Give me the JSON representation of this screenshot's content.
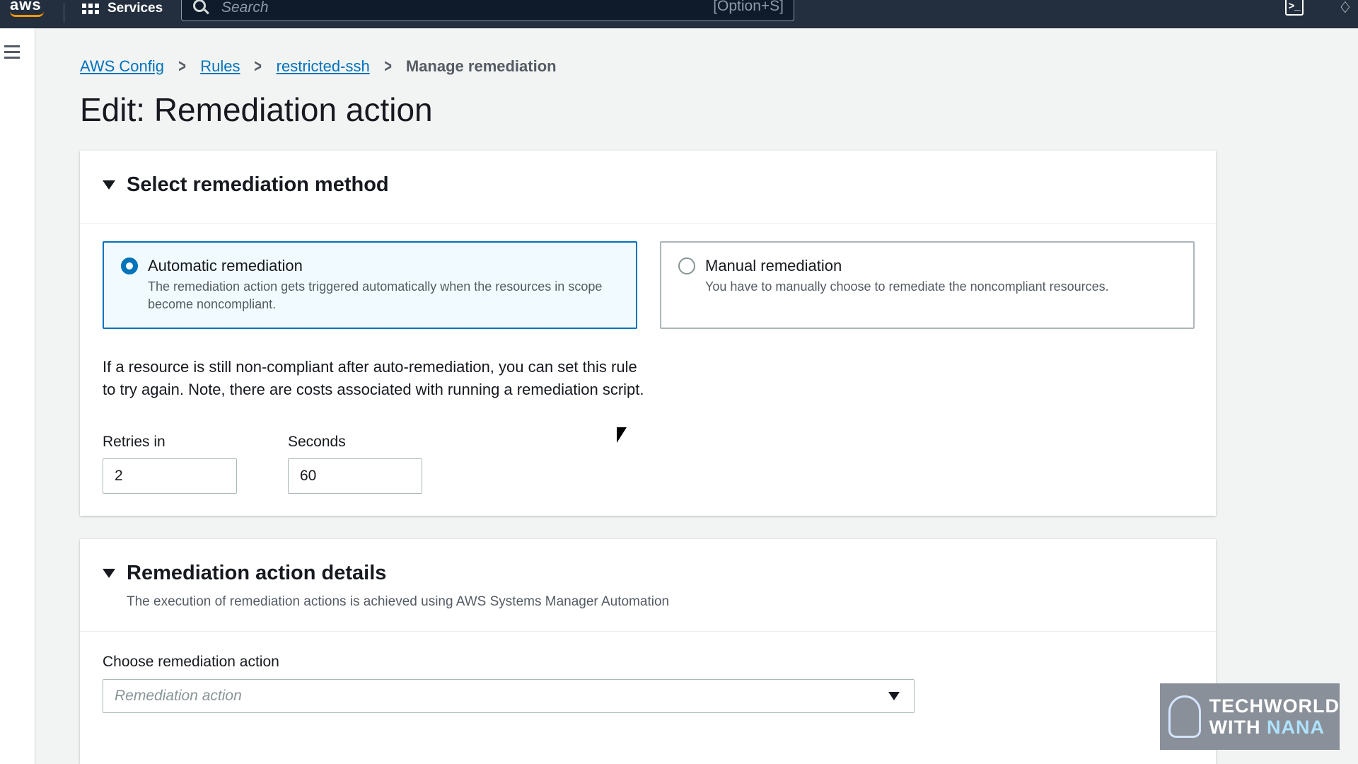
{
  "topbar": {
    "logo": "aws",
    "services_label": "Services",
    "search_placeholder": "Search",
    "search_shortcut": "[Option+S]"
  },
  "breadcrumb": [
    {
      "label": "AWS Config"
    },
    {
      "label": "Rules"
    },
    {
      "label": "restricted-ssh"
    },
    {
      "label": "Manage remediation"
    }
  ],
  "page_title": "Edit: Remediation action",
  "method_panel": {
    "title": "Select remediation method",
    "options": [
      {
        "label": "Automatic remediation",
        "description": "The remediation action gets triggered automatically when the resources in scope become noncompliant.",
        "selected": true
      },
      {
        "label": "Manual remediation",
        "description": "You have to manually choose to remediate the noncompliant resources.",
        "selected": false
      }
    ],
    "retry_note": "If a resource is still non-compliant after auto-remediation, you can set this rule to try again. Note, there are costs associated with running a remediation script.",
    "retries_label": "Retries in",
    "retries_value": "2",
    "seconds_label": "Seconds",
    "seconds_value": "60"
  },
  "details_panel": {
    "title": "Remediation action details",
    "description": "The execution of remediation actions is achieved using AWS Systems Manager Automation",
    "choose_label": "Choose remediation action",
    "select_placeholder": "Remediation action"
  },
  "watermark": {
    "line1": "TECHWORLD",
    "line2_prefix": "WITH ",
    "line2_accent": "NANA"
  },
  "colors": {
    "topbar": "#232f3e",
    "link": "#0073bb",
    "brand_orange": "#ff9900"
  }
}
